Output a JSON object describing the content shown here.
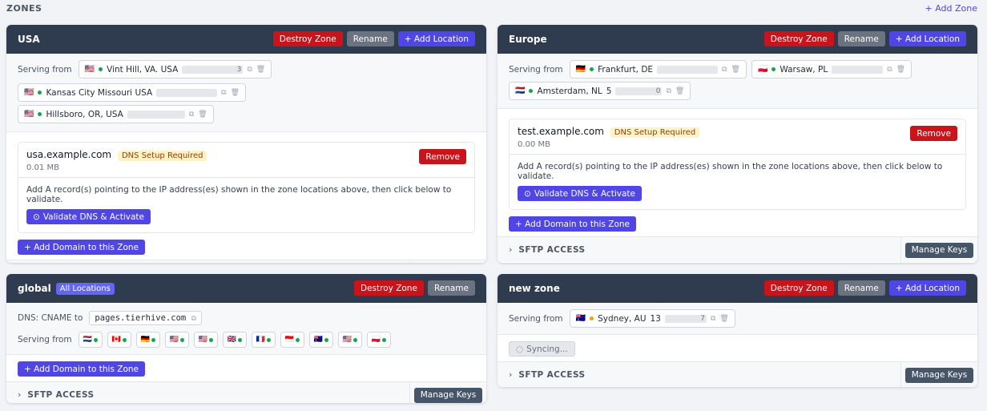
{
  "header": {
    "title": "ZONES",
    "add_zone": "+ Add Zone"
  },
  "labels": {
    "serving_from": "Serving from",
    "destroy": "Destroy Zone",
    "rename": "Rename",
    "add_location": "+ Add Location",
    "remove": "Remove",
    "dns_badge": "DNS Setup Required",
    "dns_note": "Add A record(s) pointing to the IP address(es) shown in the zone locations above, then click below to validate.",
    "validate": "Validate DNS & Activate",
    "add_domain": "+ Add Domain to this Zone",
    "sftp": "SFTP ACCESS",
    "manage_keys": "Manage Keys",
    "syncing": "Syncing...",
    "all_locations": "All Locations",
    "dns_cname_to": "DNS: CNAME to"
  },
  "zones": {
    "usa": {
      "name": "USA",
      "locations": [
        {
          "flag": "🇺🇸",
          "name": "Vint Hill, VA. USA",
          "ip_tail": "3"
        },
        {
          "flag": "🇺🇸",
          "name": "Kansas City Missouri USA",
          "ip_tail": ""
        },
        {
          "flag": "🇺🇸",
          "name": "Hillsboro, OR, USA",
          "ip_tail": ""
        }
      ],
      "domain": {
        "name": "usa.example.com",
        "size": "0.01 MB"
      }
    },
    "europe": {
      "name": "Europe",
      "locations": [
        {
          "flag": "🇩🇪",
          "name": "Frankfurt, DE",
          "ip_tail": ""
        },
        {
          "flag": "🇵🇱",
          "name": "Warsaw, PL",
          "ip_tail": ""
        },
        {
          "flag": "🇳🇱",
          "name": "Amsterdam, NL",
          "ip_head": "5",
          "ip_tail": "0"
        }
      ],
      "domain": {
        "name": "test.example.com",
        "size": "0.00 MB"
      }
    },
    "global": {
      "name": "global",
      "cname": "pages.tierhive.com",
      "flags": [
        "🇳🇱",
        "🇨🇦",
        "🇩🇪",
        "🇺🇸",
        "🇺🇸",
        "🇬🇧",
        "🇫🇷",
        "🇮🇩",
        "🇦🇺",
        "🇺🇸",
        "🇵🇱"
      ]
    },
    "newzone": {
      "name": "new zone",
      "locations": [
        {
          "flag": "🇦🇺",
          "name": "Sydney, AU",
          "ip_head": "13",
          "ip_tail": "7"
        }
      ]
    }
  }
}
